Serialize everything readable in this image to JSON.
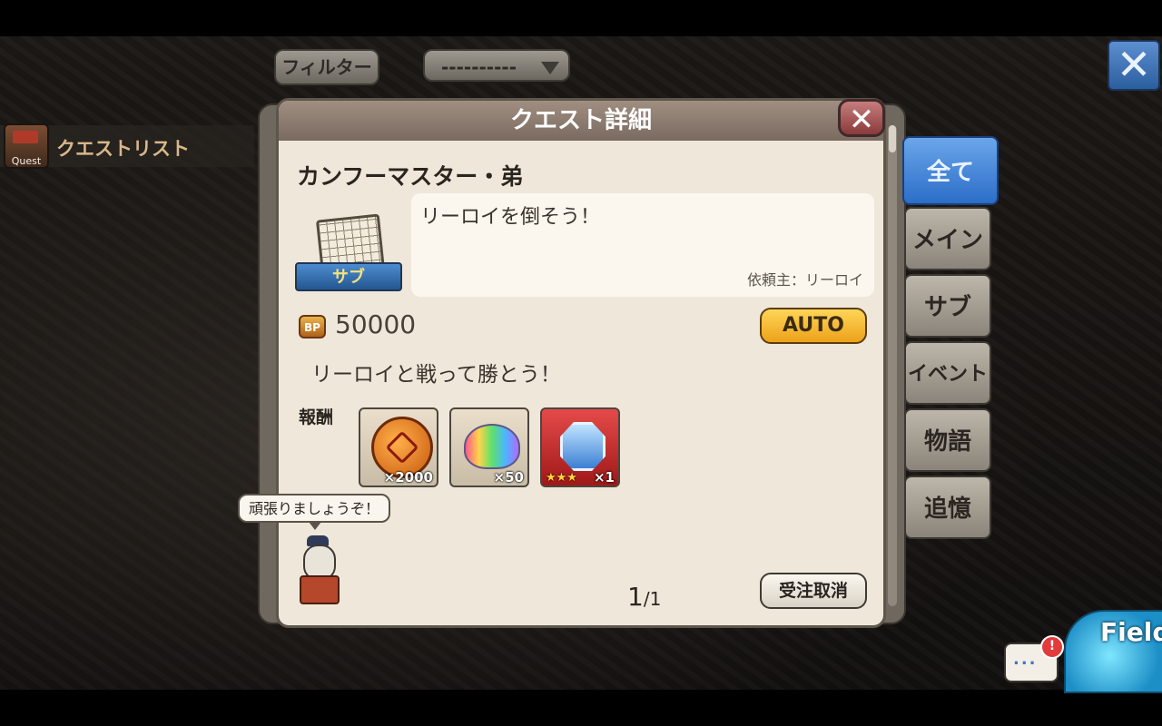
{
  "topbar": {
    "filter_label": "フィルター",
    "dropdown_value": "----------",
    "close_icon": "close-icon"
  },
  "quest_list": {
    "icon_label": "Quest",
    "title": "クエストリスト"
  },
  "tabs": [
    {
      "label": "全て",
      "active": true
    },
    {
      "label": "メイン"
    },
    {
      "label": "サブ"
    },
    {
      "label": "イベント"
    },
    {
      "label": "物語"
    },
    {
      "label": "追憶"
    }
  ],
  "dialog": {
    "title": "クエスト詳細",
    "quest_name": "カンフーマスター・弟",
    "badge_label": "サブ",
    "description": "リーロイを倒そう！",
    "client": "依頼主：リーロイ",
    "bp_icon_text": "BP",
    "bp_value": "50000",
    "auto_label": "AUTO",
    "objective": "リーロイと戦って勝とう！",
    "reward_label": "報酬",
    "rewards": [
      {
        "icon": "coin-icon",
        "qty": "×2000"
      },
      {
        "icon": "rainbow-gem-icon",
        "qty": "×50"
      },
      {
        "icon": "shield-crest-icon",
        "stars": "★★★",
        "qty": "×1"
      }
    ],
    "page_current": "1",
    "page_total": "/1",
    "cancel_label": "受注取消"
  },
  "mascot": {
    "speech": "頑張りましょうぞ！"
  },
  "hud": {
    "chat_dots": "...",
    "chat_alert": "!",
    "field_label": "Field"
  }
}
